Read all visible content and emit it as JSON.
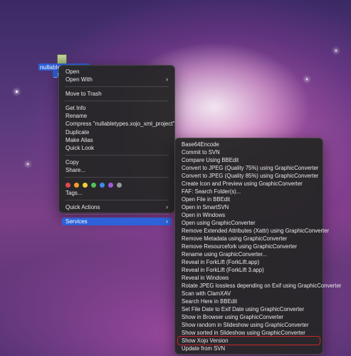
{
  "desktop": {
    "file_label_line1": "nullabletypes.xojo",
    "file_label_line2": "_xml_",
    "file_icon": "xml-document-icon"
  },
  "context_menu": {
    "group1": [
      "Open",
      "Open With"
    ],
    "group2": [
      "Move to Trash"
    ],
    "group3": [
      "Get Info",
      "Rename",
      "Compress \"nullabletypes.xojo_xml_project\"",
      "Duplicate",
      "Make Alias",
      "Quick Look"
    ],
    "group4": [
      "Copy",
      "Share..."
    ],
    "tag_colors": [
      "#e5484d",
      "#f39c2b",
      "#f1cf3a",
      "#4fc15a",
      "#3b8cf0",
      "#a05ae0",
      "#9a9a9a"
    ],
    "tags_label": "Tags...",
    "quick_actions": "Quick Actions",
    "services": "Services",
    "submenu_chevron": "›"
  },
  "services_menu": {
    "items": [
      "Base64Encode",
      "Commit to SVN",
      "Compare Using BBEdit",
      "Convert to JPEG (Quality 75%) using GraphicConverter",
      "Convert to JPEG (Quality 85%) using GraphicConverter",
      "Create Icon and Preview using GraphicConverter",
      "FAF: Search Folder(s)...",
      "Open File in BBEdit",
      "Open in SmartSVN",
      "Open in Windows",
      "Open using GraphicConverter",
      "Remove Extended Attributes (Xattr) using GraphicConverter",
      "Remove Metadata using GraphicConverter",
      "Remove Resourcefork using GraphicConverter",
      "Rename using GraphicConverter...",
      "Reveal in ForkLift (ForkLift.app)",
      "Reveal in ForkLift (ForkLift 3.app)",
      "Reveal in Windows",
      "Rotate JPEG lossless depending on Exif using GraphicConverter",
      "Scan with ClamXAV",
      "Search Here in BBEdit",
      "Set File Date to Exif Date using GraphicConverter",
      "Show in Browser using GraphicConverter",
      "Show random in Slideshow using GraphicConverter",
      "Show sorted in Slideshow using GraphicConverter",
      "Show Xojo Version",
      "Update from SVN"
    ],
    "marked_item": "Show Xojo Version",
    "highlight_color": "#2d62d8",
    "marker_color": "#c8262e"
  }
}
